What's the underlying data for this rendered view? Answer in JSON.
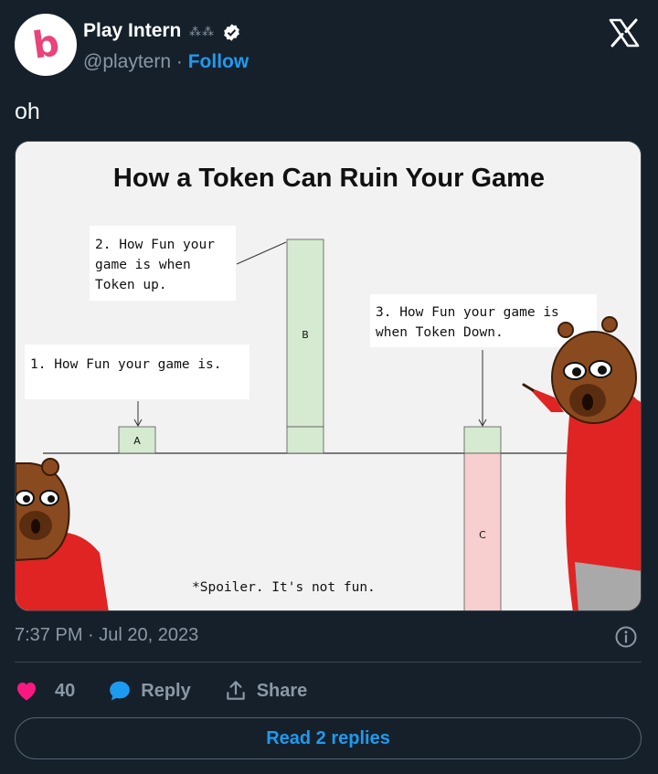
{
  "author": {
    "display_name": "Play Intern",
    "handle": "@playtern",
    "separator": "·",
    "follow_label": "Follow",
    "avatar_letter": "b",
    "avatar_color": "#e9437a"
  },
  "tweet": {
    "text": "oh",
    "timestamp": "7:37 PM · Jul 20, 2023"
  },
  "image": {
    "title": "How a Token Can Ruin Your Game",
    "box1_lines": [
      "1.  How Fun your game is."
    ],
    "box2_lines": [
      "2. How Fun your",
      "game is when",
      "Token up."
    ],
    "box3_lines": [
      "3. How Fun your game is",
      "when Token Down."
    ],
    "bar_a_label": "A",
    "bar_b_label": "B",
    "bar_c_label": "C",
    "footnote": "*Spoiler. It's not fun.",
    "bar_colors": {
      "positive": "#d5ead0",
      "negative": "#f7cfcf"
    }
  },
  "actions": {
    "like_count": "40",
    "reply_label": "Reply",
    "share_label": "Share",
    "like_color": "#f91880",
    "reply_color": "#1d9bf0"
  },
  "read_replies_label": "Read 2 replies",
  "icons": {
    "platform": "x-logo-icon",
    "verified": "verified-badge-icon",
    "info": "info-icon",
    "like": "heart-icon",
    "reply": "speech-bubble-icon",
    "share": "share-upload-icon"
  }
}
